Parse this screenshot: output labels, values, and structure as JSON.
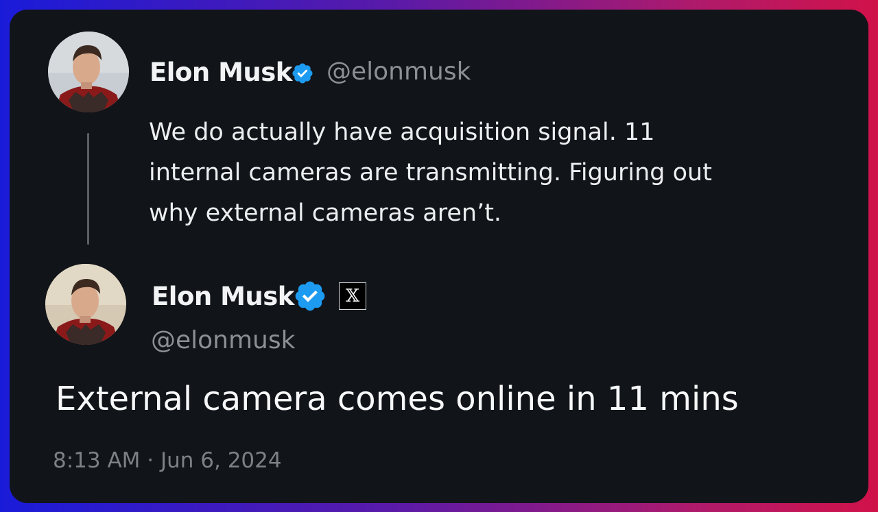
{
  "quoted_tweet": {
    "author_name": "Elon Musk",
    "author_handle": "@elonmusk",
    "text": "We do actually have acquisition signal. 11 internal cameras are transmitting. Figuring out why external cameras aren’t."
  },
  "main_tweet": {
    "author_name": "Elon Musk",
    "author_handle": "@elonmusk",
    "affiliate_badge": "𝕏",
    "text": "External camera comes online in 11 mins",
    "timestamp": "8:13 AM · Jun 6, 2024"
  },
  "colors": {
    "card_background": "#111418",
    "verified_blue": "#1d9bf0",
    "gradient_left": "#1a1bd9",
    "gradient_right": "#d1124a"
  },
  "icons": {
    "verified": "verified-badge-icon",
    "affiliate": "x-logo-icon",
    "avatar": "profile-photo"
  }
}
